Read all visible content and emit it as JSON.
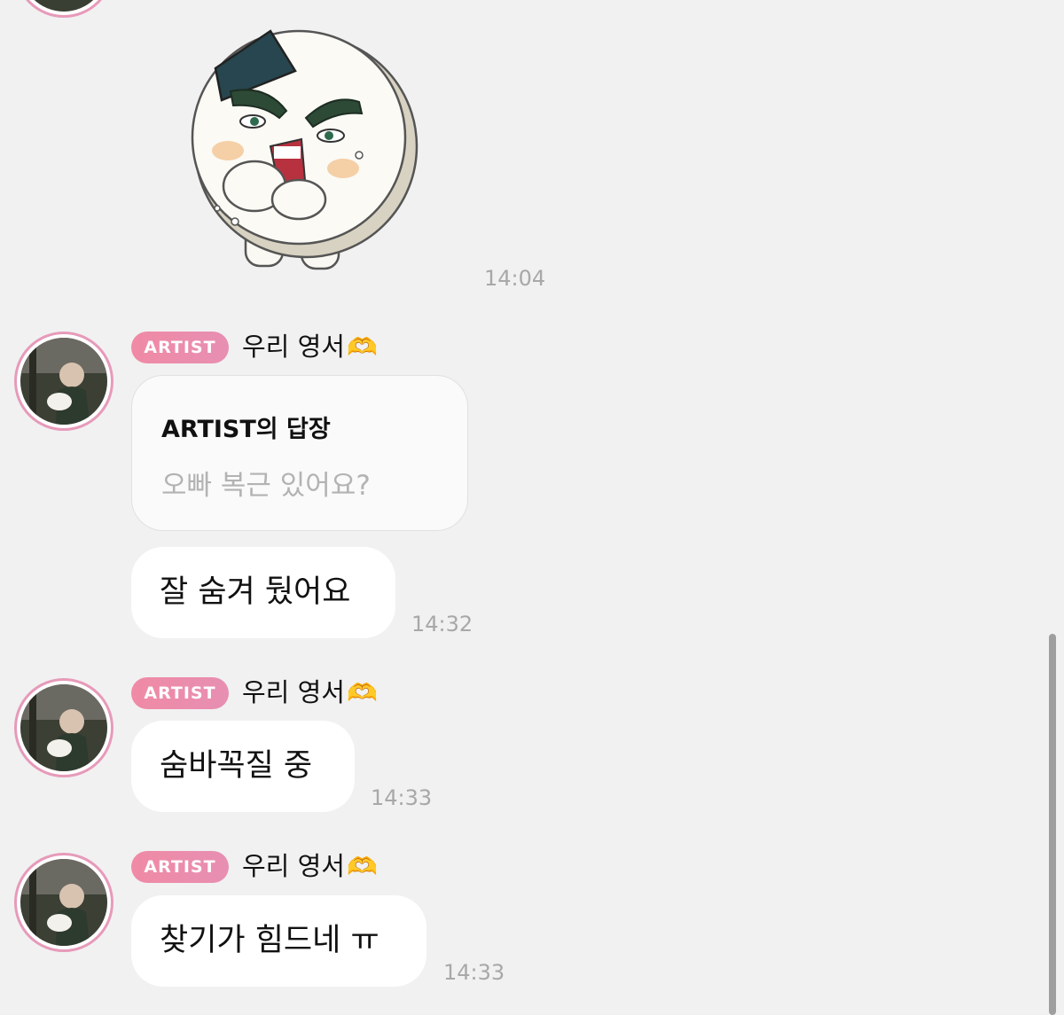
{
  "colors": {
    "background": "#f1f1f1",
    "bubble": "#ffffff",
    "artist_badge": "#ef8aa6",
    "avatar_ring": "#e79ab9",
    "timestamp": "#a8a8a8"
  },
  "sticker_message": {
    "sticker": "rice-ball-character-sticker",
    "time": "14:04"
  },
  "messages": [
    {
      "badge": "ARTIST",
      "sender": "우리 영서",
      "sender_emoji": "🫶",
      "reply": {
        "title": "ARTIST의 답장",
        "quote": "오빠 복근 있어요?"
      },
      "text": "잘 숨겨 뒀어요",
      "time": "14:32"
    },
    {
      "badge": "ARTIST",
      "sender": "우리 영서",
      "sender_emoji": "🫶",
      "text": "숨바꼭질 중",
      "time": "14:33"
    },
    {
      "badge": "ARTIST",
      "sender": "우리 영서",
      "sender_emoji": "🫶",
      "text": "찾기가 힘드네 ㅠ",
      "time": "14:33"
    }
  ]
}
